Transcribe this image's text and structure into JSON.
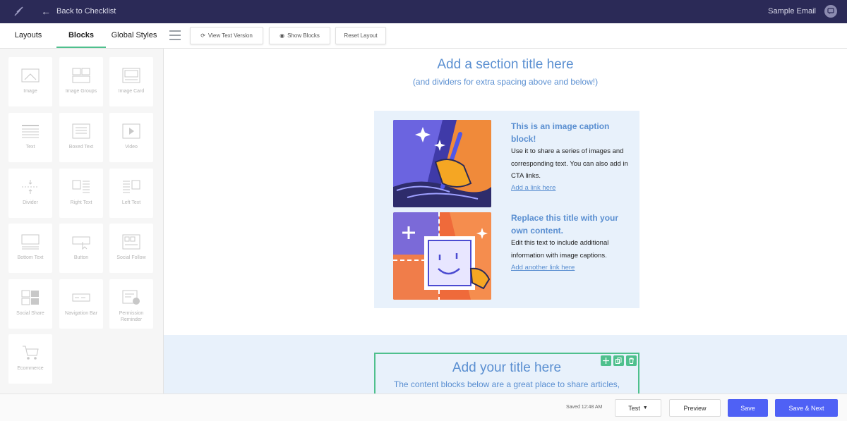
{
  "topbar": {
    "back_label": "Back to Checklist",
    "email_name": "Sample Email",
    "logo_icon": "feather-logo-icon",
    "feedback_icon": "chat-icon"
  },
  "tabs": [
    {
      "label": "Layouts",
      "active": false
    },
    {
      "label": "Blocks",
      "active": true
    },
    {
      "label": "Global Styles",
      "active": false
    }
  ],
  "toolbar": {
    "view_text_label": "View Text Version",
    "show_blocks_label": "Show Blocks",
    "reset_layout_label": "Reset Layout"
  },
  "sidebar": {
    "blocks": [
      {
        "label": "Image",
        "icon": "image-icon"
      },
      {
        "label": "Image Groups",
        "icon": "image-groups-icon"
      },
      {
        "label": "Image Card",
        "icon": "image-card-icon"
      },
      {
        "label": "Text",
        "icon": "text-icon"
      },
      {
        "label": "Boxed Text",
        "icon": "boxed-text-icon"
      },
      {
        "label": "Video",
        "icon": "video-icon"
      },
      {
        "label": "Divider",
        "icon": "divider-icon"
      },
      {
        "label": "Right Text",
        "icon": "right-text-icon"
      },
      {
        "label": "Left Text",
        "icon": "left-text-icon"
      },
      {
        "label": "Bottom Text",
        "icon": "bottom-text-icon"
      },
      {
        "label": "Button",
        "icon": "button-icon"
      },
      {
        "label": "Social Follow",
        "icon": "social-follow-icon"
      },
      {
        "label": "Social Share",
        "icon": "social-share-icon"
      },
      {
        "label": "Navigation Bar",
        "icon": "navigation-bar-icon"
      },
      {
        "label": "Permission Reminder",
        "icon": "permission-reminder-icon"
      },
      {
        "label": "Ecommerce",
        "icon": "cart-icon"
      }
    ]
  },
  "canvas": {
    "section_title": "Add a section title here",
    "section_subtitle": "(and dividers for extra spacing above and below!)",
    "caption_1": {
      "title": "This is an image caption block!",
      "body": "Use it to share a series of images and corresponding text. You can also add in CTA links.",
      "link": "Add a link here"
    },
    "caption_2": {
      "title": "Replace this title with your own content.",
      "body": "Edit this text to include additional information with image captions.",
      "link": "Add another link here"
    },
    "selected_block": {
      "title": "Add your title here",
      "body": "The content blocks below are a great place to share articles,"
    }
  },
  "footer": {
    "saved_text": "Saved 12:48 AM",
    "test_label": "Test",
    "preview_label": "Preview",
    "save_label": "Save",
    "save_next_label": "Save & Next"
  },
  "colors": {
    "topbar": "#2b2a57",
    "accent": "#4fc08d",
    "primary": "#4f61f5",
    "title_blue": "#5a8fd1",
    "light_blue": "#e8f1fb"
  }
}
